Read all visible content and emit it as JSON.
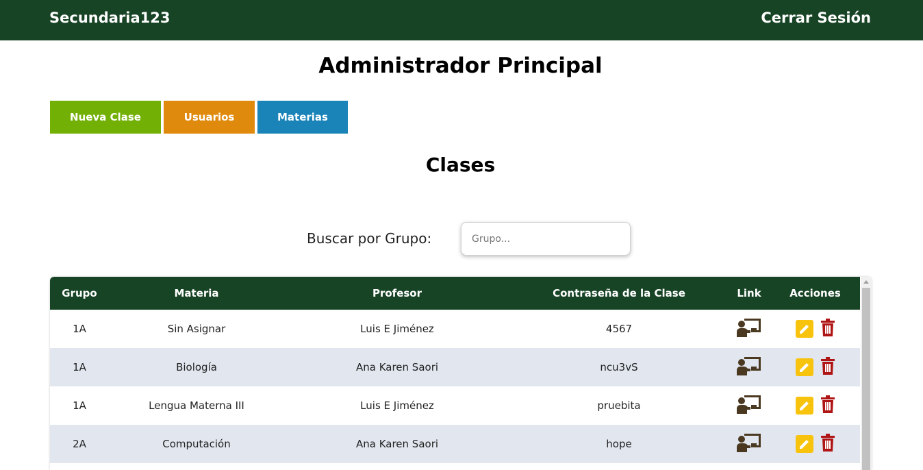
{
  "header": {
    "brand": "Secundaria123",
    "logout_label": "Cerrar Sesión"
  },
  "page_title": "Administrador Principal",
  "actions": {
    "new_class_label": "Nueva Clase",
    "users_label": "Usuarios",
    "subjects_label": "Materias"
  },
  "section_title": "Clases",
  "search": {
    "label": "Buscar por Grupo:",
    "placeholder": "Grupo...",
    "value": ""
  },
  "table": {
    "columns": [
      "Grupo",
      "Materia",
      "Profesor",
      "Contraseña de la Clase",
      "Link",
      "Acciones"
    ],
    "rows": [
      {
        "grupo": "1A",
        "materia": "Sin Asignar",
        "profesor": "Luis E Jiménez",
        "password": "4567"
      },
      {
        "grupo": "1A",
        "materia": "Biología",
        "profesor": "Ana Karen Saori",
        "password": "ncu3vS"
      },
      {
        "grupo": "1A",
        "materia": "Lengua Materna III",
        "profesor": "Luis E Jiménez",
        "password": "pruebita"
      },
      {
        "grupo": "2A",
        "materia": "Computación",
        "profesor": "Ana Karen Saori",
        "password": "hope"
      }
    ]
  },
  "icons": {
    "link": "teacher-presentation-icon",
    "edit": "pencil-icon",
    "delete": "trash-icon"
  },
  "colors": {
    "header_bg": "#184426",
    "new_class": "#72b005",
    "users": "#df8a0c",
    "subjects": "#1a84b8",
    "edit": "#f7c30c",
    "delete": "#b01515",
    "link_icon": "#4a3820",
    "row_alt": "#e1e6ef"
  }
}
